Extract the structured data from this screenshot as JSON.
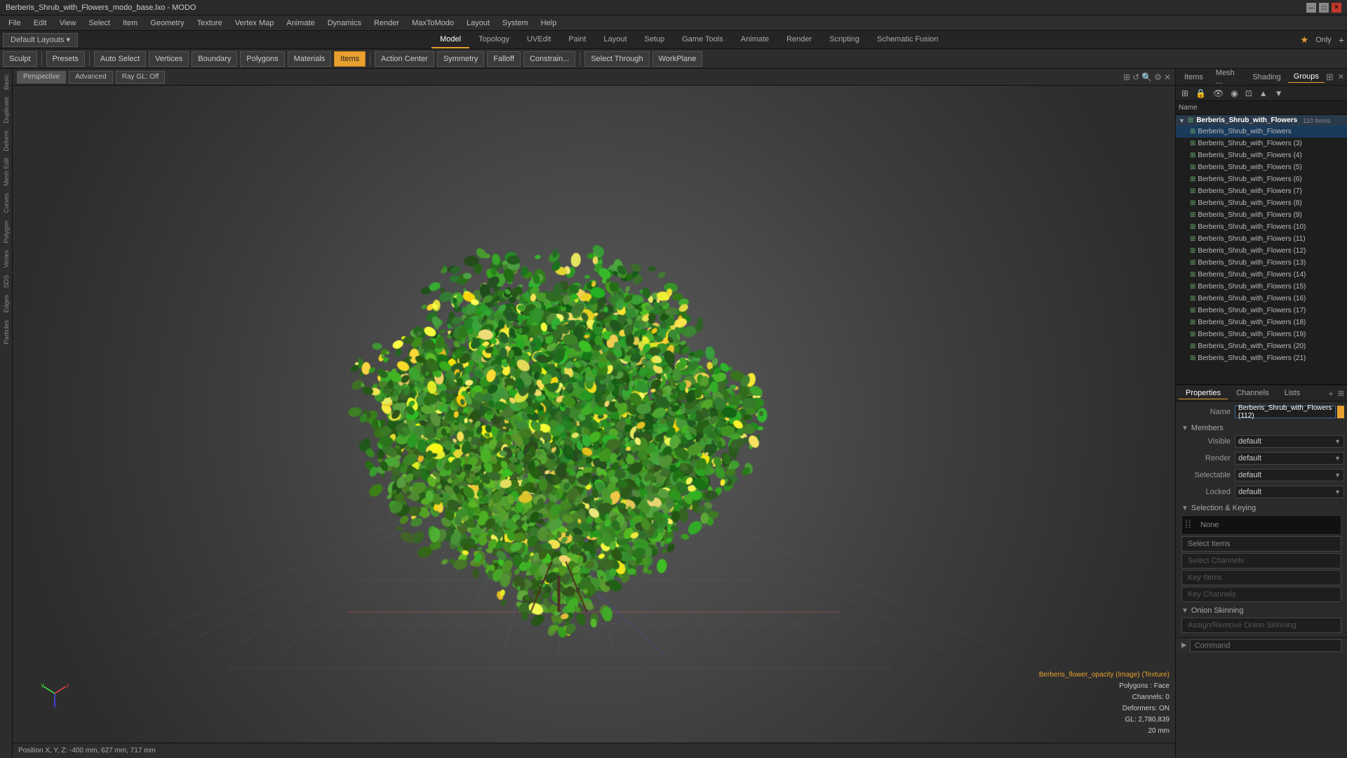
{
  "window": {
    "title": "Berberis_Shrub_with_Flowers_modo_base.lxo - MODO"
  },
  "titlebar": {
    "minimize": "─",
    "maximize": "□",
    "close": "✕"
  },
  "menubar": {
    "items": [
      "File",
      "Edit",
      "View",
      "Select",
      "Item",
      "Geometry",
      "Texture",
      "Vertex Map",
      "Animate",
      "Dynamics",
      "Render",
      "MaxToModo",
      "Layout",
      "System",
      "Help"
    ]
  },
  "modetabs": {
    "layout_btn": "Default Layouts ▾",
    "tabs": [
      {
        "label": "Model",
        "active": true
      },
      {
        "label": "Topology",
        "active": false
      },
      {
        "label": "UVEdit",
        "active": false
      },
      {
        "label": "Paint",
        "active": false
      },
      {
        "label": "Layout",
        "active": false
      },
      {
        "label": "Setup",
        "active": false
      },
      {
        "label": "Game Tools",
        "active": false
      },
      {
        "label": "Animate",
        "active": false
      },
      {
        "label": "Render",
        "active": false
      },
      {
        "label": "Scripting",
        "active": false
      },
      {
        "label": "Schematic Fusion",
        "active": false
      }
    ],
    "star": "★",
    "only": "Only",
    "add": "+"
  },
  "toolbar": {
    "sculpt": "Sculpt",
    "presets": "Presets",
    "auto_select": "Auto Select",
    "vertices": "Vertices",
    "boundary": "Boundary",
    "polygons": "Polygons",
    "materials": "Materials",
    "items": "Items",
    "action_center": "Action Center",
    "symmetry": "Symmetry",
    "falloff": "Falloff",
    "constraints": "Constrain...",
    "select_through": "Select Through",
    "workplane": "WorkPlane"
  },
  "viewport": {
    "perspective": "Perspective",
    "advanced": "Advanced",
    "ray_gl": "Ray GL: Off"
  },
  "left_sidebar": {
    "icons": [
      "Basic",
      "Duplicate",
      "Deform",
      "Mesh Edit",
      "Curves",
      "Polygon",
      "Vertex",
      "SDS",
      "Edges",
      "Particles"
    ]
  },
  "viewport_status": {
    "texture": "Berberis_flower_opacity (Image) (Texture)",
    "polygons": "Polygons : Face",
    "channels": "Channels: 0",
    "deformers": "Deformers: ON",
    "gl": "GL: 2,780,839",
    "mm": "20 mm"
  },
  "bottom_bar": {
    "position": "Position X, Y, Z:  -400 mm, 627 mm, 717 mm"
  },
  "command_bar": {
    "placeholder": "Command"
  },
  "items_panel": {
    "tabs": [
      "Items",
      "Mesh ...",
      "Shading",
      "Groups"
    ],
    "active_tab": "Groups",
    "toolbar_icons": [
      "new_group",
      "lock",
      "eye",
      "render",
      "select",
      "move_up",
      "move_down"
    ],
    "name_header": "Name",
    "group_name": "Berberis_Shrub_with_Flowers",
    "group_count": "110 Items",
    "items": [
      "Berberis_Shrub_with_Flowers",
      "Berberis_Shrub_with_Flowers (3)",
      "Berberis_Shrub_with_Flowers (4)",
      "Berberis_Shrub_with_Flowers (5)",
      "Berberis_Shrub_with_Flowers (6)",
      "Berberis_Shrub_with_Flowers (7)",
      "Berberis_Shrub_with_Flowers (8)",
      "Berberis_Shrub_with_Flowers (9)",
      "Berberis_Shrub_with_Flowers (10)",
      "Berberis_Shrub_with_Flowers (11)",
      "Berberis_Shrub_with_Flowers (12)",
      "Berberis_Shrub_with_Flowers (13)",
      "Berberis_Shrub_with_Flowers (14)",
      "Berberis_Shrub_with_Flowers (15)",
      "Berberis_Shrub_with_Flowers (16)",
      "Berberis_Shrub_with_Flowers (17)",
      "Berberis_Shrub_with_Flowers (18)",
      "Berberis_Shrub_with_Flowers (19)",
      "Berberis_Shrub_with_Flowers (20)",
      "Berberis_Shrub_with_Flowers (21)"
    ]
  },
  "properties": {
    "tabs": [
      "Properties",
      "Channels",
      "Lists"
    ],
    "add_tab": "+",
    "name_label": "Name",
    "name_value": "Berberis_Shrub_with_Flowers (112)",
    "members_section": "Members",
    "visible_label": "Visible",
    "visible_value": "default",
    "render_label": "Render",
    "render_value": "default",
    "selectable_label": "Selectable",
    "selectable_value": "default",
    "locked_label": "Locked",
    "locked_value": "default",
    "selection_keying_section": "Selection & Keying",
    "keying_none": "None",
    "select_items_btn": "Select Items",
    "select_channels_btn": "Select Channels",
    "key_items_btn": "Key Items",
    "key_channels_btn": "Key Channels",
    "onion_skinning_section": "Onion Skinning",
    "assign_remove_btn": "Assign/Remove Onion Skinning"
  }
}
